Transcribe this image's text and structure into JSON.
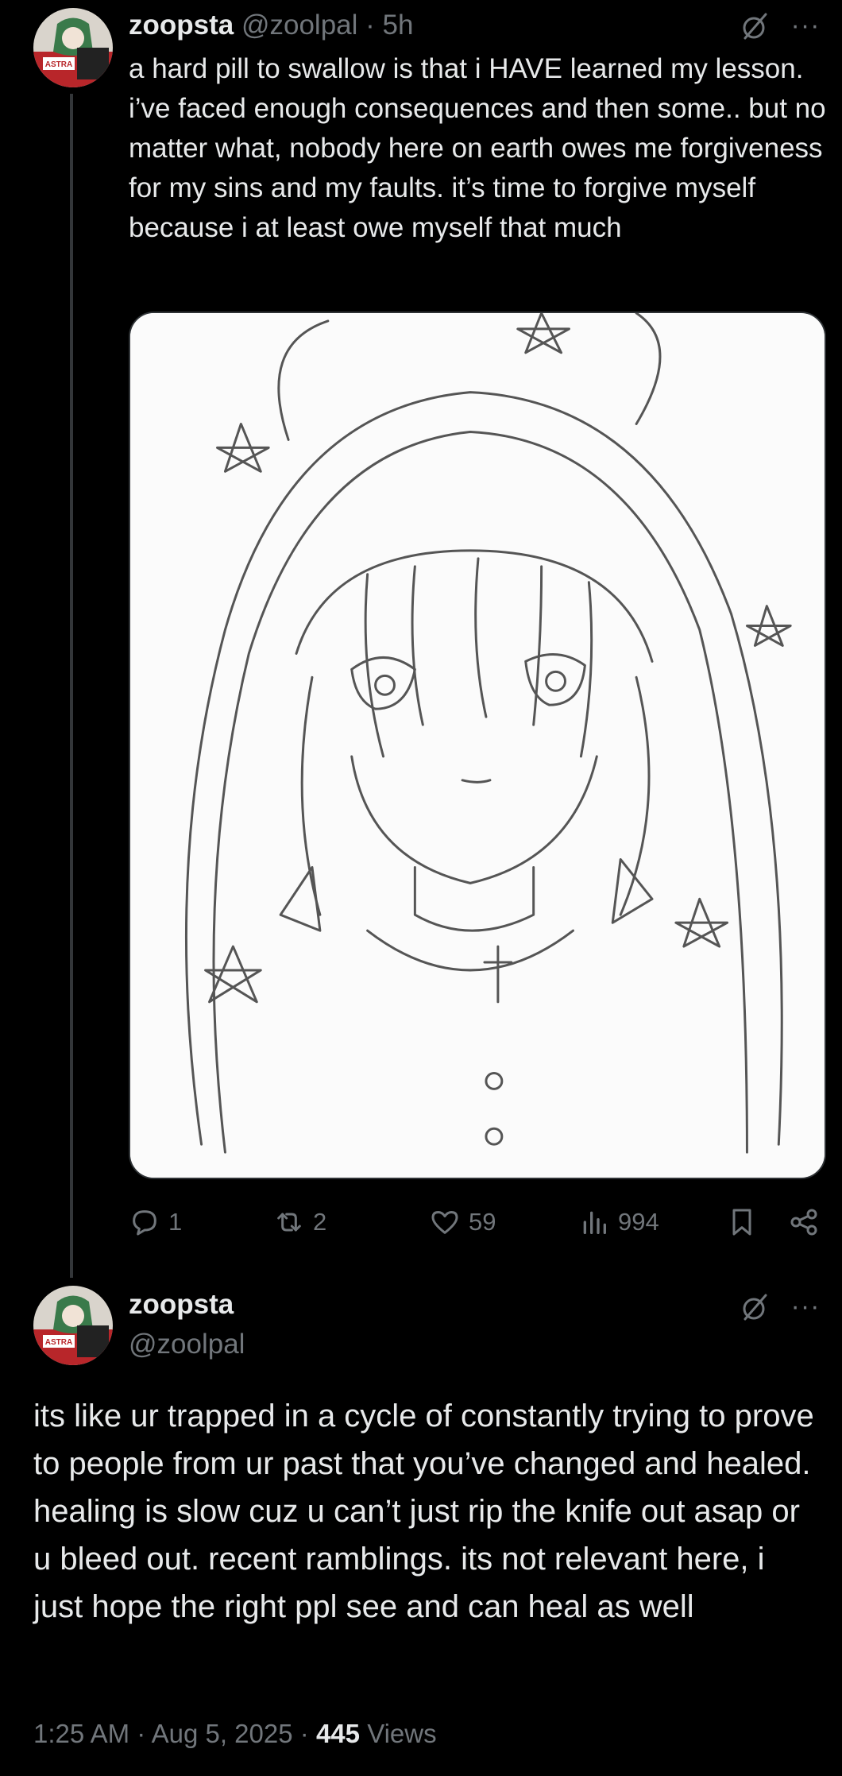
{
  "tweet1": {
    "author_name": "zoopsta",
    "author_handle": "@zoolpal",
    "separator": "·",
    "time": "5h",
    "text": "a hard pill to swallow is that i HAVE learned my lesson. i’ve faced enough consequences and then some.. but no matter what, nobody here on earth owes me forgiveness for my sins and my faults. it’s time to forgive myself because i at least owe myself that much",
    "avatar_caption": "ASTRA",
    "media_icon": "anime-sketch-image",
    "actions": {
      "replies": "1",
      "reposts": "2",
      "likes": "59",
      "views": "994"
    }
  },
  "tweet2": {
    "author_name": "zoopsta",
    "author_handle": "@zoolpal",
    "text": "its like ur trapped in a cycle of constantly trying to prove to people from ur past that you’ve changed and healed. healing is slow cuz u can’t just rip the knife out asap or u bleed out. recent ramblings. its not relevant here, i just hope the right ppl see and can heal as well",
    "time": "1:25 AM",
    "date": "Aug 5, 2025",
    "separator": "·",
    "views_count": "445",
    "views_label": "Views"
  },
  "icons": {
    "grok": "grok-icon",
    "more": "more-icon",
    "reply": "reply-icon",
    "repost": "repost-icon",
    "like": "heart-icon",
    "views": "views-chart-icon",
    "bookmark": "bookmark-icon",
    "share": "share-icon"
  },
  "colors": {
    "background": "#000000",
    "text_primary": "#e7e9ea",
    "text_secondary": "#71767b",
    "thread_line": "#333639"
  },
  "more_glyph": "···"
}
